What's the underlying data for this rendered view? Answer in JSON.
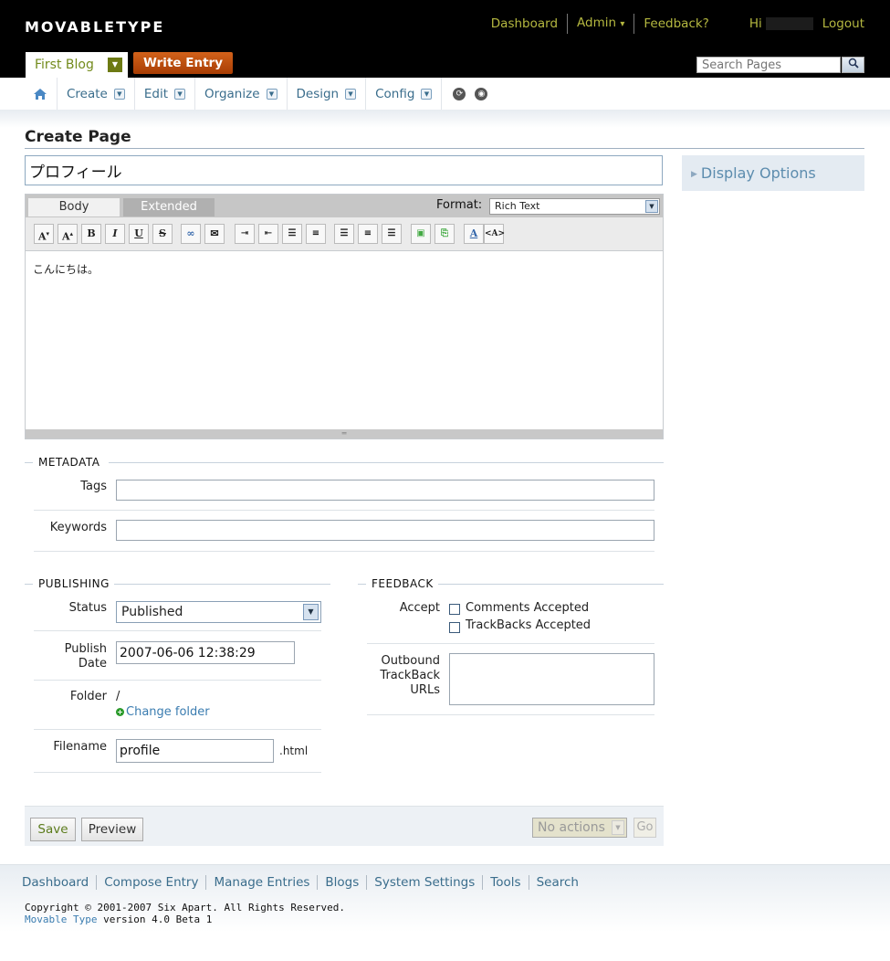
{
  "header": {
    "logo": "MOVABLETYPE",
    "nav": [
      "Dashboard",
      "Admin",
      "Feedback?"
    ],
    "greeting": "Hi",
    "logout": "Logout",
    "admin_arrow": "▾",
    "blog_name": "First Blog",
    "write_entry": "Write Entry",
    "search_placeholder": "Search Pages"
  },
  "mainnav": {
    "items": [
      "Create",
      "Edit",
      "Organize",
      "Design",
      "Config"
    ]
  },
  "page": {
    "title": "Create Page",
    "title_value": "プロフィール",
    "display_options": "Display Options"
  },
  "editor": {
    "tabs": [
      "Body",
      "Extended"
    ],
    "format_label": "Format:",
    "format_value": "Rich Text",
    "body_text": "こんにちは。",
    "toolbar_icons": [
      "font-size-decrease-icon",
      "font-size-increase-icon",
      "bold-icon",
      "italic-icon",
      "underline-icon",
      "strikethrough-icon",
      "link-icon",
      "email-icon",
      "indent-icon",
      "outdent-icon",
      "bullet-list-icon",
      "numbered-list-icon",
      "align-left-icon",
      "align-center-icon",
      "align-right-icon",
      "insert-image-icon",
      "insert-file-icon",
      "text-color-icon",
      "html-mode-icon"
    ]
  },
  "metadata": {
    "heading": "METADATA",
    "tags_label": "Tags",
    "tags_value": "",
    "keywords_label": "Keywords",
    "keywords_value": ""
  },
  "publishing": {
    "heading": "PUBLISHING",
    "status_label": "Status",
    "status_value": "Published",
    "date_label": "Publish Date",
    "date_value": "2007-06-06 12:38:29",
    "folder_label": "Folder",
    "folder_value": "/",
    "change_folder": "Change folder",
    "filename_label": "Filename",
    "filename_value": "profile",
    "extension": ".html"
  },
  "feedback": {
    "heading": "FEEDBACK",
    "accept_label": "Accept",
    "comments_label": "Comments Accepted",
    "comments_checked": false,
    "trackbacks_label": "TrackBacks Accepted",
    "trackbacks_checked": false,
    "outbound_label": "Outbound TrackBack URLs",
    "outbound_value": ""
  },
  "actions": {
    "save": "Save",
    "preview": "Preview",
    "actions_select": "No actions",
    "go": "Go"
  },
  "footer": {
    "links": [
      "Dashboard",
      "Compose Entry",
      "Manage Entries",
      "Blogs",
      "System Settings",
      "Tools",
      "Search"
    ],
    "copyright": "Copyright © 2001-2007 Six Apart. All Rights Reserved.",
    "product_link": "Movable Type",
    "version_text": " version 4.0 Beta 1"
  }
}
